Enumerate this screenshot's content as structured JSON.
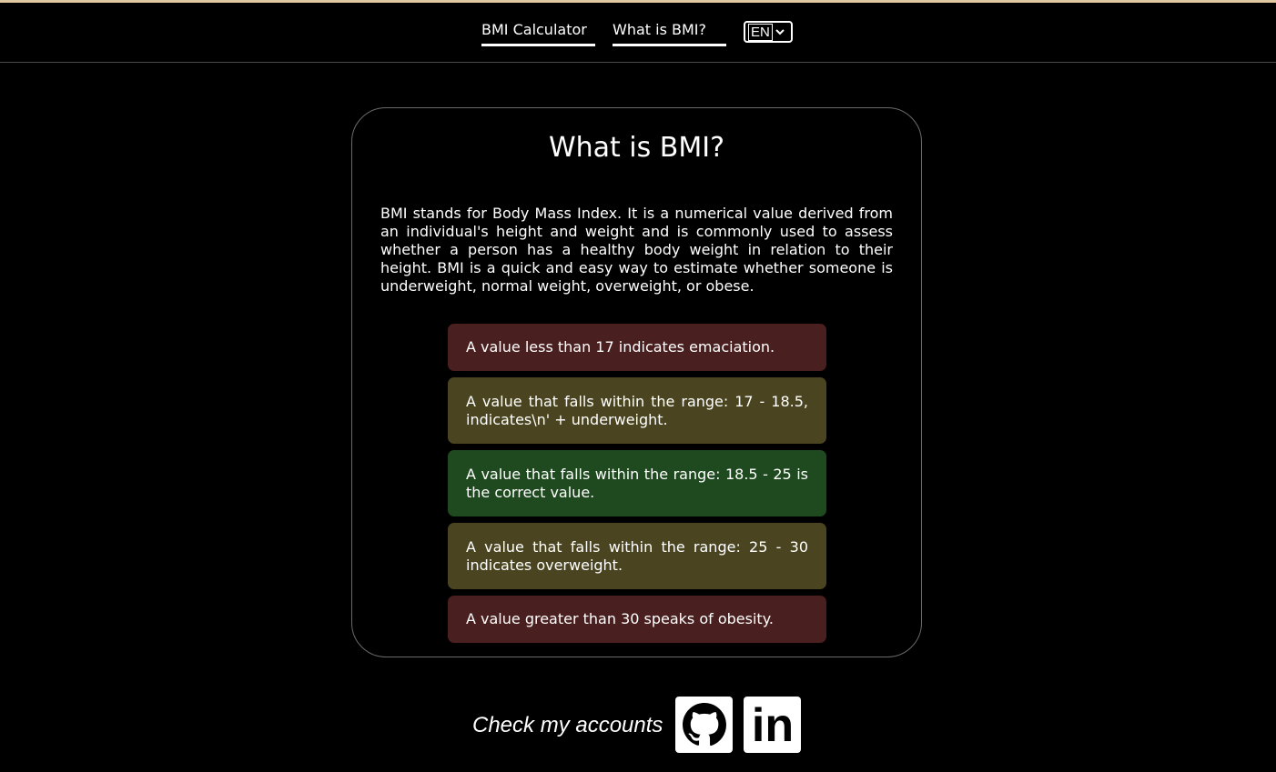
{
  "nav": {
    "links": [
      {
        "label": "BMI Calculator"
      },
      {
        "label": "What is BMI?"
      }
    ],
    "language": {
      "selected": "EN"
    }
  },
  "card": {
    "title": "What is BMI?",
    "description": "BMI stands for Body Mass Index. It is a numerical value derived from an individual's height and weight and is commonly used to assess whether a person has a healthy body weight in relation to their height. BMI is a quick and easy way to estimate whether someone is underweight, normal weight, overweight, or obese.",
    "ranges": [
      {
        "text": "A value less than 17 indicates emaciation.",
        "color": "#4a1f1f"
      },
      {
        "text": "A value that falls within the range: 17 - 18.5, indicates\\n' + underweight.",
        "color": "#4a4520"
      },
      {
        "text": "A value that falls within the range: 18.5 - 25 is the correct value.",
        "color": "#1f4a1f"
      },
      {
        "text": "A value that falls within the range: 25 - 30 indicates overweight.",
        "color": "#4a4520"
      },
      {
        "text": "A value greater than 30 speaks of obesity.",
        "color": "#4a1f1f"
      }
    ]
  },
  "footer": {
    "text": "Check my accounts",
    "accounts": [
      {
        "icon": "github-icon"
      },
      {
        "icon": "linkedin-icon",
        "text": "in"
      }
    ]
  },
  "colors": {
    "accent_top": "#e0c9a0",
    "background": "#000000",
    "text": "#ffffff"
  }
}
